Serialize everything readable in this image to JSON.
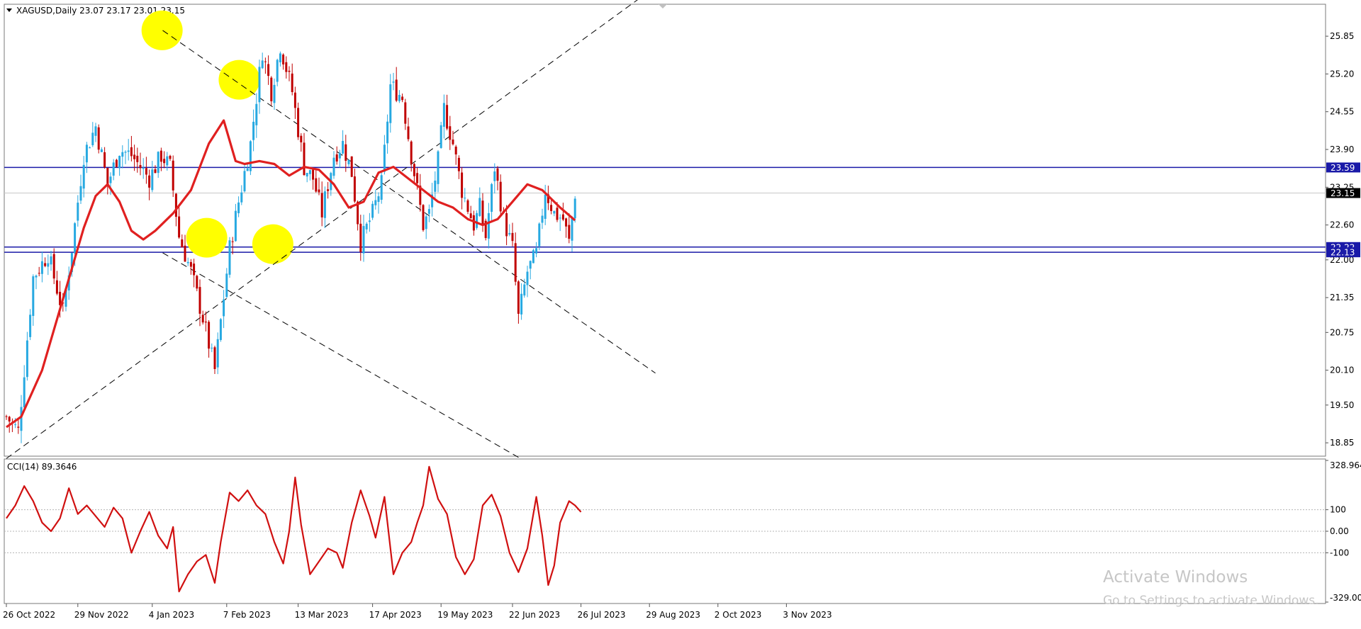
{
  "main_chart": {
    "symbol_line": "XAGUSD,Daily  23.07 23.17 23.01 23.15",
    "price_ticks": [
      "25.85",
      "25.20",
      "24.55",
      "23.90",
      "23.25",
      "22.60",
      "22.00",
      "21.35",
      "20.75",
      "20.10",
      "19.50",
      "18.85"
    ],
    "price_ticks_values": [
      25.85,
      25.2,
      24.55,
      23.9,
      23.25,
      22.6,
      22.0,
      21.35,
      20.75,
      20.1,
      19.5,
      18.85
    ],
    "price_range": [
      18.62,
      26.4
    ],
    "level_labels": [
      {
        "text": "23.59",
        "value": 23.59,
        "style": "blue"
      },
      {
        "text": "23.15",
        "value": 23.15,
        "style": "black"
      },
      {
        "text": "22.22",
        "value": 22.22,
        "style": "blue"
      },
      {
        "text": "22.13",
        "value": 22.13,
        "style": "blue"
      }
    ],
    "horizontal_levels": [
      23.59,
      22.22,
      22.13
    ],
    "current_price": 23.15,
    "trendlines": [
      {
        "from": [
          0.0,
          18.58
        ],
        "to": [
          218.0,
          26.7
        ]
      },
      {
        "from": [
          52.5,
          25.95
        ],
        "to": [
          218.0,
          20.05
        ]
      },
      {
        "from": [
          52.5,
          22.12
        ],
        "to": [
          172.0,
          18.6
        ]
      }
    ],
    "highlighted_circles": [
      {
        "x": 52.3,
        "y": 25.95
      },
      {
        "x": 78.2,
        "y": 25.1
      },
      {
        "x": 67.3,
        "y": 22.38
      },
      {
        "x": 89.5,
        "y": 22.27
      }
    ]
  },
  "cci_panel": {
    "label": "CCI(14) 89.3646",
    "range_labels": [
      "328.964",
      "100",
      "0.00",
      "-100",
      "-329.000"
    ],
    "levels": [
      100,
      0,
      -100
    ],
    "range": [
      -329.0,
      328.964
    ]
  },
  "x_axis": {
    "labels": [
      "26 Oct 2022",
      "29 Nov 2022",
      "4 Jan 2023",
      "7 Feb 2023",
      "13 Mar 2023",
      "17 Apr 2023",
      "19 May 2023",
      "22 Jun 2023",
      "26 Jul 2023",
      "29 Aug 2023",
      "2 Oct 2023",
      "3 Nov 2023"
    ],
    "label_index": [
      0,
      24,
      49,
      74,
      98,
      123,
      146,
      170,
      193,
      216,
      239,
      262
    ]
  },
  "watermark": {
    "line1": "Activate Windows",
    "line2": "Go to Settings to activate Windows."
  },
  "colors": {
    "candle": "#27a9e1",
    "candle_down": "#c00000",
    "ma": "#e02020",
    "cci": "#d01010",
    "level_line": "#1a1aa8",
    "trendline": "#000000",
    "highlight": "#ffff00"
  },
  "chart_data": [
    {
      "type": "candlestick",
      "title": "XAGUSD,Daily",
      "x_unit": "trading days since 26 Oct 2022 (tick labels in x_axis)",
      "ylim": [
        18.62,
        26.4
      ],
      "anchors": [
        [
          0,
          19.3
        ],
        [
          4,
          19.05
        ],
        [
          9,
          21.7
        ],
        [
          14,
          22.1
        ],
        [
          19,
          21.1
        ],
        [
          22,
          22.2
        ],
        [
          26,
          23.8
        ],
        [
          30,
          24.3
        ],
        [
          34,
          23.3
        ],
        [
          38,
          23.9
        ],
        [
          42,
          23.8
        ],
        [
          48,
          23.4
        ],
        [
          52,
          23.8
        ],
        [
          55,
          23.6
        ],
        [
          58,
          22.4
        ],
        [
          62,
          21.8
        ],
        [
          66,
          21.0
        ],
        [
          70,
          20.1
        ],
        [
          75,
          22.2
        ],
        [
          78,
          23.0
        ],
        [
          82,
          24.0
        ],
        [
          86,
          25.6
        ],
        [
          89,
          24.9
        ],
        [
          92,
          25.7
        ],
        [
          96,
          24.9
        ],
        [
          100,
          23.6
        ],
        [
          103,
          23.4
        ],
        [
          106,
          22.8
        ],
        [
          110,
          23.8
        ],
        [
          113,
          24.0
        ],
        [
          116,
          23.5
        ],
        [
          119,
          22.3
        ],
        [
          123,
          22.8
        ],
        [
          126,
          23.3
        ],
        [
          129,
          25.0
        ],
        [
          133,
          24.8
        ],
        [
          136,
          23.8
        ],
        [
          140,
          22.6
        ],
        [
          142,
          22.8
        ],
        [
          145,
          23.7
        ],
        [
          147,
          24.6
        ],
        [
          150,
          24.0
        ],
        [
          153,
          23.2
        ],
        [
          157,
          22.6
        ],
        [
          159,
          22.9
        ],
        [
          161,
          22.4
        ],
        [
          164,
          23.6
        ],
        [
          167,
          22.7
        ],
        [
          170,
          22.2
        ],
        [
          172,
          21.0
        ],
        [
          175,
          21.8
        ],
        [
          178,
          22.1
        ],
        [
          181,
          23.2
        ],
        [
          184,
          22.8
        ],
        [
          187,
          22.7
        ],
        [
          189,
          22.3
        ],
        [
          191,
          23.15
        ]
      ]
    },
    {
      "type": "line",
      "title": "Moving average (red)",
      "points": [
        [
          0,
          19.12
        ],
        [
          5,
          19.3
        ],
        [
          12,
          20.1
        ],
        [
          20,
          21.5
        ],
        [
          26,
          22.55
        ],
        [
          30,
          23.1
        ],
        [
          34,
          23.3
        ],
        [
          38,
          23.0
        ],
        [
          42,
          22.5
        ],
        [
          46,
          22.35
        ],
        [
          50,
          22.5
        ],
        [
          56,
          22.8
        ],
        [
          62,
          23.2
        ],
        [
          68,
          24.0
        ],
        [
          73,
          24.4
        ],
        [
          77,
          23.7
        ],
        [
          80,
          23.65
        ],
        [
          85,
          23.7
        ],
        [
          90,
          23.65
        ],
        [
          95,
          23.45
        ],
        [
          100,
          23.6
        ],
        [
          105,
          23.55
        ],
        [
          110,
          23.3
        ],
        [
          115,
          22.9
        ],
        [
          120,
          23.0
        ],
        [
          125,
          23.5
        ],
        [
          130,
          23.6
        ],
        [
          135,
          23.4
        ],
        [
          140,
          23.2
        ],
        [
          145,
          23.0
        ],
        [
          150,
          22.9
        ],
        [
          155,
          22.7
        ],
        [
          160,
          22.6
        ],
        [
          165,
          22.7
        ],
        [
          170,
          23.0
        ],
        [
          175,
          23.3
        ],
        [
          180,
          23.2
        ],
        [
          186,
          22.9
        ],
        [
          191,
          22.68
        ]
      ]
    },
    {
      "type": "line",
      "title": "CCI(14)",
      "ylim": [
        -329.0,
        328.964
      ],
      "points": [
        [
          0,
          60
        ],
        [
          3,
          120
        ],
        [
          6,
          210
        ],
        [
          9,
          140
        ],
        [
          12,
          40
        ],
        [
          15,
          0
        ],
        [
          18,
          60
        ],
        [
          21,
          200
        ],
        [
          24,
          80
        ],
        [
          27,
          120
        ],
        [
          30,
          70
        ],
        [
          33,
          20
        ],
        [
          36,
          110
        ],
        [
          39,
          60
        ],
        [
          42,
          -100
        ],
        [
          45,
          0
        ],
        [
          48,
          90
        ],
        [
          51,
          -20
        ],
        [
          54,
          -80
        ],
        [
          56,
          20
        ],
        [
          58,
          -280
        ],
        [
          61,
          -200
        ],
        [
          64,
          -140
        ],
        [
          67,
          -110
        ],
        [
          70,
          -240
        ],
        [
          72,
          -50
        ],
        [
          75,
          180
        ],
        [
          78,
          140
        ],
        [
          81,
          190
        ],
        [
          84,
          120
        ],
        [
          87,
          80
        ],
        [
          90,
          -50
        ],
        [
          93,
          -150
        ],
        [
          95,
          0
        ],
        [
          97,
          250
        ],
        [
          99,
          30
        ],
        [
          102,
          -200
        ],
        [
          105,
          -140
        ],
        [
          108,
          -80
        ],
        [
          111,
          -100
        ],
        [
          113,
          -170
        ],
        [
          116,
          40
        ],
        [
          119,
          190
        ],
        [
          122,
          70
        ],
        [
          124,
          -30
        ],
        [
          127,
          160
        ],
        [
          130,
          -200
        ],
        [
          133,
          -100
        ],
        [
          136,
          -50
        ],
        [
          138,
          40
        ],
        [
          140,
          120
        ],
        [
          142,
          300
        ],
        [
          145,
          150
        ],
        [
          148,
          80
        ],
        [
          151,
          -120
        ],
        [
          154,
          -200
        ],
        [
          157,
          -130
        ],
        [
          160,
          120
        ],
        [
          163,
          170
        ],
        [
          166,
          70
        ],
        [
          169,
          -100
        ],
        [
          172,
          -190
        ],
        [
          175,
          -80
        ],
        [
          178,
          160
        ],
        [
          180,
          -20
        ],
        [
          182,
          -250
        ],
        [
          184,
          -160
        ],
        [
          186,
          40
        ],
        [
          189,
          140
        ],
        [
          191,
          120
        ],
        [
          193,
          89.36
        ]
      ]
    }
  ]
}
